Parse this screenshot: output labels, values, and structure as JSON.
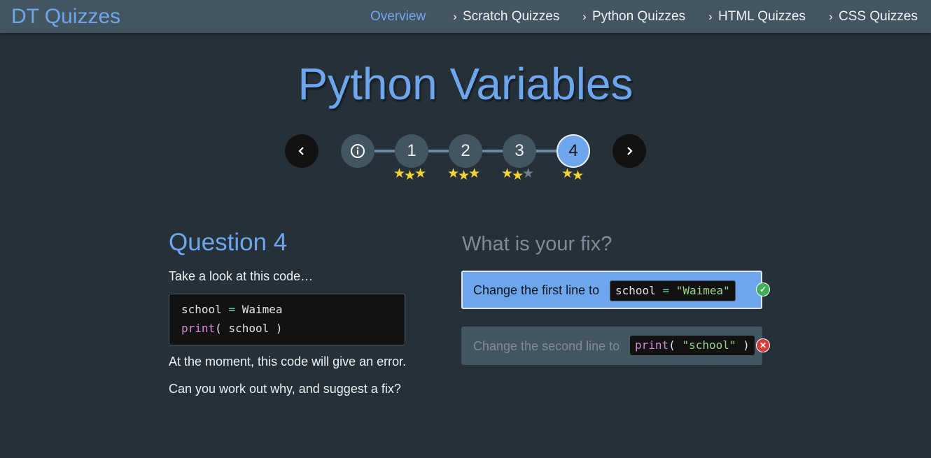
{
  "nav": {
    "brand": "DT Quizzes",
    "links": [
      {
        "label": "Overview"
      },
      {
        "label": "Scratch Quizzes"
      },
      {
        "label": "Python Quizzes"
      },
      {
        "label": "HTML Quizzes"
      },
      {
        "label": "CSS Quizzes"
      }
    ]
  },
  "title": "Python Variables",
  "stepper": {
    "info_symbol": "ⓘ",
    "steps": [
      {
        "label": "1",
        "stars_earned": 3,
        "stars_total": 3
      },
      {
        "label": "2",
        "stars_earned": 3,
        "stars_total": 3
      },
      {
        "label": "3",
        "stars_earned": 2,
        "stars_total": 3
      },
      {
        "label": "4",
        "stars_earned": 2,
        "stars_total": 2
      }
    ],
    "current_step": "4"
  },
  "question": {
    "heading": "Question 4",
    "intro": "Take a look at this code…",
    "code": {
      "line1_var": "school",
      "line1_op": "=",
      "line1_val": "Waimea",
      "line2_fn": "print",
      "line2_args": "( school )"
    },
    "problem": "At the moment, this code will give an error.",
    "prompt": "Can you work out why, and suggest a fix?"
  },
  "answers": {
    "heading": "What is your fix?",
    "options": [
      {
        "text": "Change the first line to",
        "code_var": "school",
        "code_op": "=",
        "code_str": "\"Waimea\"",
        "status": "correct"
      },
      {
        "text": "Change the second line to",
        "code_fn": "print",
        "code_open": "( ",
        "code_str": "\"school\"",
        "code_close": " )",
        "status": "wrong"
      }
    ]
  },
  "colors": {
    "background": "#263038",
    "navbar": "#435561",
    "accent": "#6ea6ee",
    "star": "#f5d533",
    "correct": "#3fae56",
    "wrong": "#d83a3a"
  }
}
